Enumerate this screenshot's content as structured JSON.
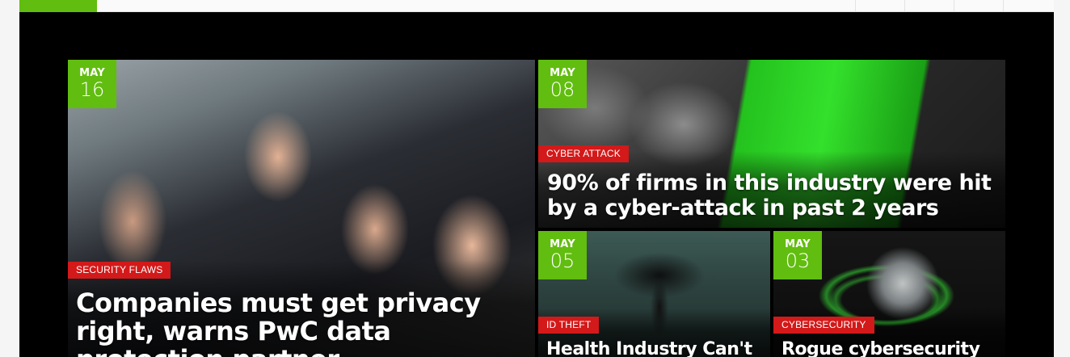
{
  "nav": {
    "accent_color": "#61bd0f"
  },
  "featured": {
    "posts": [
      {
        "date_month": "MAY",
        "date_day": "16",
        "category": "SECURITY FLAWS",
        "title": "Companies must get privacy right, warns PwC data protection partner"
      },
      {
        "date_month": "MAY",
        "date_day": "08",
        "category": "CYBER ATTACK",
        "title": "90% of firms in this industry were hit by a cyber-attack in past 2 years"
      },
      {
        "date_month": "MAY",
        "date_day": "05",
        "category": "ID THEFT",
        "title": "Health Industry Can't"
      },
      {
        "date_month": "MAY",
        "date_day": "03",
        "category": "CYBERSECURITY",
        "title": "Rogue cybersecurity"
      }
    ]
  },
  "colors": {
    "date_badge": "#61bd0f",
    "category_badge": "#d31919"
  }
}
